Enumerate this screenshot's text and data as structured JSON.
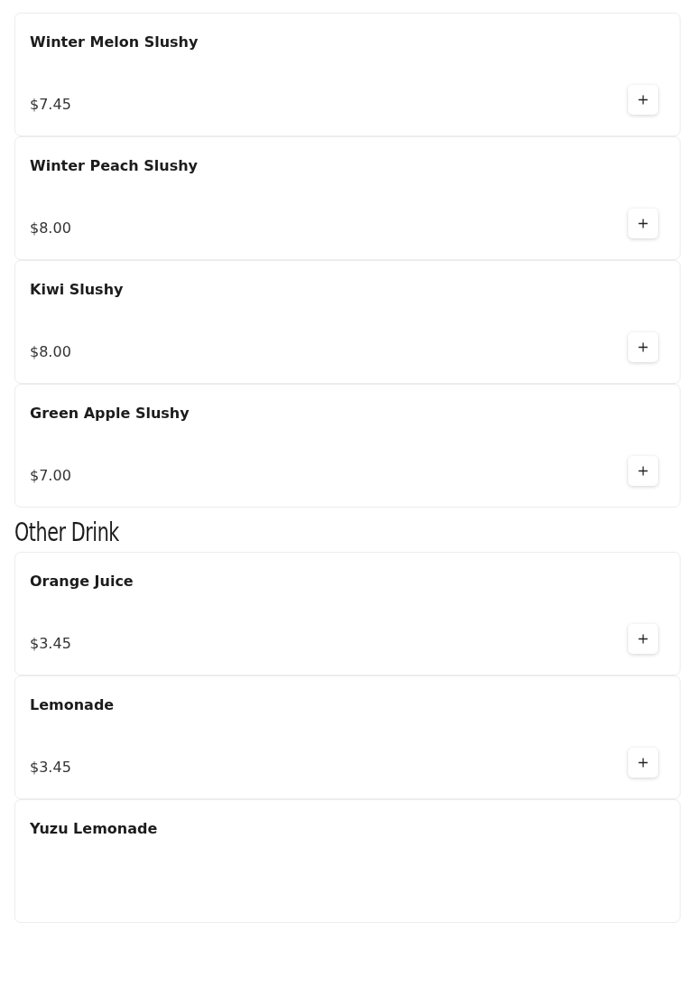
{
  "sections": [
    {
      "items": [
        {
          "name": "Winter Melon Slushy",
          "price": "$7.45"
        },
        {
          "name": "Winter Peach Slushy",
          "price": "$8.00"
        },
        {
          "name": "Kiwi Slushy",
          "price": "$8.00"
        },
        {
          "name": "Green Apple Slushy",
          "price": "$7.00"
        }
      ]
    },
    {
      "heading": "Other Drink",
      "items": [
        {
          "name": "Orange Juice",
          "price": "$3.45"
        },
        {
          "name": "Lemonade",
          "price": "$3.45"
        },
        {
          "name": "Yuzu Lemonade"
        }
      ]
    }
  ]
}
